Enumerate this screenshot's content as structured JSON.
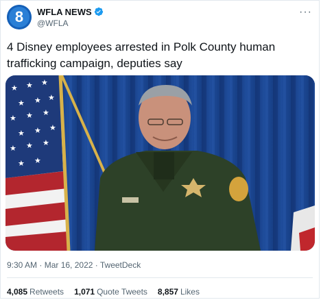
{
  "account": {
    "display_name": "WFLA NEWS",
    "handle": "@WFLA",
    "avatar_number": "8",
    "avatar_icon": "wfla-8-logo",
    "verified_icon": "verified-badge-icon"
  },
  "more_icon": "more-options-icon",
  "more_glyph": "···",
  "tweet": {
    "text": "4 Disney employees arrested in Polk County human trafficking campaign, deputies say"
  },
  "media": {
    "subject": "news-conference-photo"
  },
  "meta": {
    "time": "9:30 AM",
    "sep1": " · ",
    "date": "Mar 16, 2022",
    "sep2": " · ",
    "source": "TweetDeck"
  },
  "stats": {
    "retweets_count": "4,085",
    "retweets_label": "Retweets",
    "quotes_count": "1,071",
    "quotes_label": "Quote Tweets",
    "likes_count": "8,857",
    "likes_label": "Likes"
  },
  "colors": {
    "accent": "#1d9bf0",
    "text": "#0f1419",
    "secondary": "#536471",
    "avatar_bg": "#1560b8"
  }
}
